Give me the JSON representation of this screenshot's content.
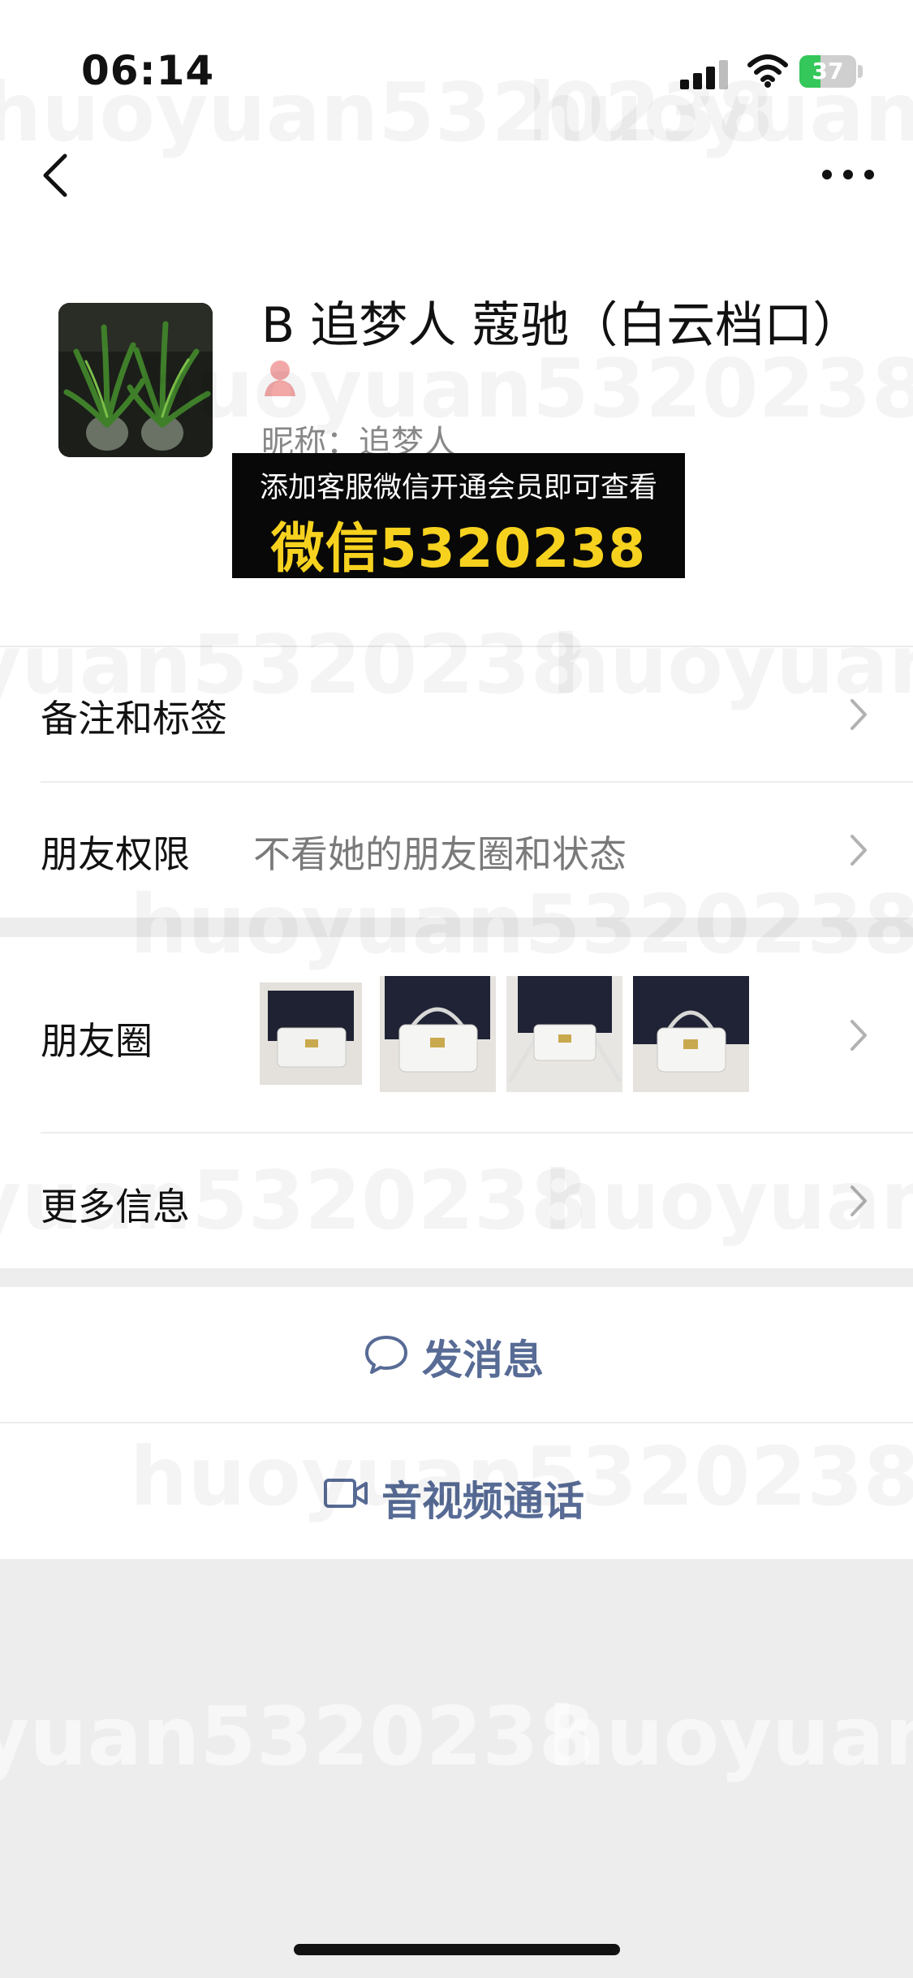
{
  "status_bar": {
    "time": "06:14",
    "battery": "37",
    "battery_level": 0.37
  },
  "profile": {
    "name": "B 追梦人 蔻驰（白云档口）",
    "nickname": "昵称：追梦人"
  },
  "promo": {
    "line1": "添加客服微信开通会员即可查看",
    "line2": "微信5320238"
  },
  "rows": {
    "remark": {
      "label": "备注和标签"
    },
    "permission": {
      "label": "朋友权限",
      "value": "不看她的朋友圈和状态"
    },
    "moments": {
      "label": "朋友圈"
    },
    "more_info": {
      "label": "更多信息"
    }
  },
  "actions": {
    "message": "发消息",
    "call": "音视频通话"
  },
  "watermark": "huoyuan5320238",
  "colors": {
    "link": "#576b95",
    "promo_highlight": "#f6d21f",
    "battery_green": "#34c759"
  }
}
